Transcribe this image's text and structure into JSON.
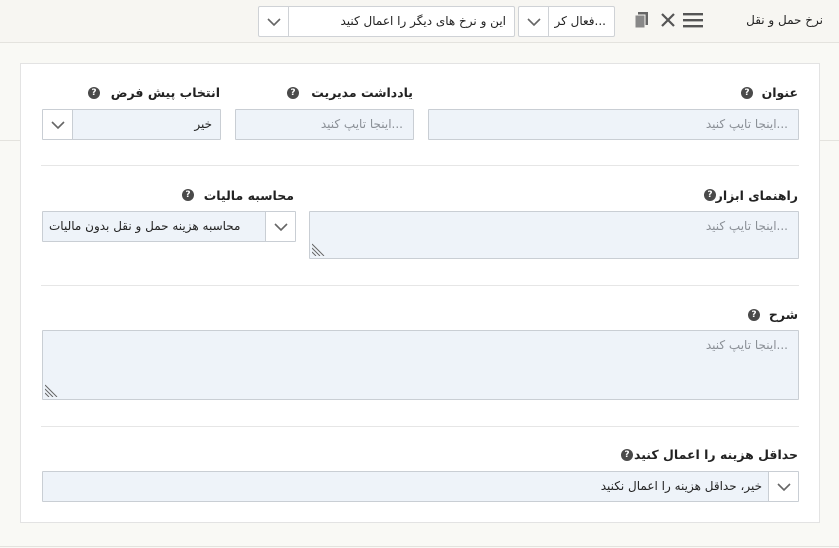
{
  "header": {
    "title": "نرخ حمل و نقل",
    "status_value": "فعال کر...",
    "apply_value": "این و نرخ های دیگر را اعمال کنید",
    "icons": [
      "menu-icon",
      "close-icon",
      "copy-icon"
    ]
  },
  "form": {
    "title_field": {
      "label": "عنوان",
      "placeholder": "اینجا تایپ کنید..."
    },
    "admin_note": {
      "label": "یادداشت مدیریت",
      "placeholder": "اینجا تایپ کنید..."
    },
    "default_select": {
      "label": "انتخاب پیش فرض",
      "value": "خیر"
    },
    "tooltip": {
      "label": "راهنمای ابزار",
      "placeholder": "اینجا تایپ کنید..."
    },
    "tax_calc": {
      "label": "محاسبه مالیات",
      "value": "محاسبه هزینه حمل و نقل بدون مالیات"
    },
    "description": {
      "label": "شرح",
      "placeholder": "اینجا تایپ کنید..."
    },
    "min_cost": {
      "label": "حداقل هزینه را اعمال کنید",
      "value": "خیر، حداقل هزینه را اعمال نکنید"
    }
  },
  "help_glyph": "?"
}
